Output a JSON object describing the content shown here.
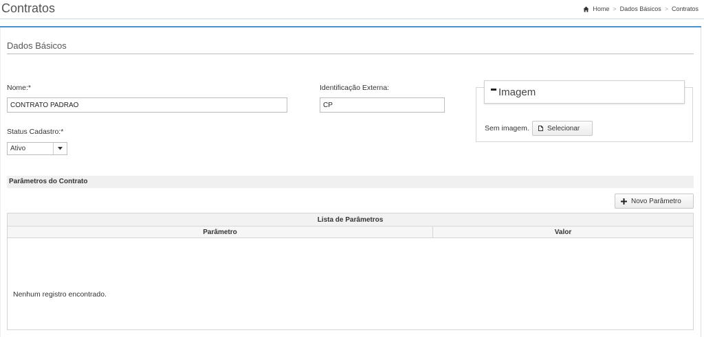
{
  "header": {
    "title": "Contratos",
    "breadcrumb": {
      "home": "Home",
      "separator": ">",
      "level1": "Dados Básicos",
      "level2": "Contratos"
    }
  },
  "section": {
    "title": "Dados Básicos"
  },
  "form": {
    "nome_label": "Nome:*",
    "nome_value": "CONTRATO PADRAO",
    "ident_label": "Identificação Externa:",
    "ident_value": "CP",
    "status_label": "Status Cadastro:*",
    "status_value": "Ativo"
  },
  "image_panel": {
    "title": "Imagem",
    "no_image_text": "Sem imagem.",
    "select_label": "Selecionar"
  },
  "parameters": {
    "section_title": "Parâmetros do Contrato",
    "new_button": "Novo Parâmetro",
    "table_title": "Lista de Parâmetros",
    "columns": [
      "Parâmetro",
      "Valor"
    ],
    "empty_message": "Nenhum registro encontrado."
  },
  "colors": {
    "accent": "#4a90c8"
  }
}
